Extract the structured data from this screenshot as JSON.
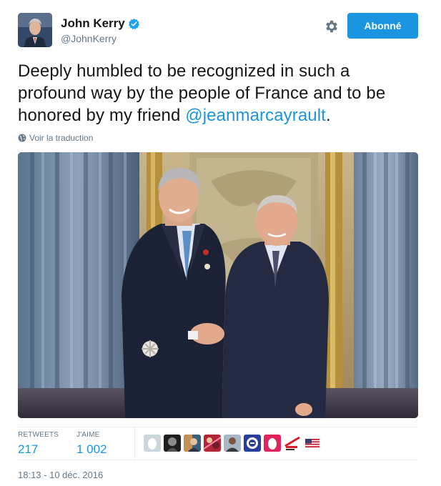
{
  "user": {
    "name": "John Kerry",
    "handle": "@JohnKerry"
  },
  "follow_button": {
    "label": "Abonné"
  },
  "tweet": {
    "text_before": "Deeply humbled to be recognized in such a profound way by the people of France and to be honored by my friend ",
    "mention": "@jeanmarcayrault",
    "text_after": "."
  },
  "translate_link": "Voir la traduction",
  "stats": {
    "retweets_label": "RETWEETS",
    "retweets_value": "217",
    "likes_label": "J'AIME",
    "likes_value": "1 002"
  },
  "liker_avatars": [
    "default-egg-avatar",
    "dark-portrait-avatar",
    "colorful-avatar",
    "red-pattern-avatar",
    "person-avatar",
    "blue-logo-avatar",
    "pink-egg-avatar",
    "text-logo-avatar",
    "us-flag-avatar"
  ],
  "timestamp": "18:13 - 10 déc. 2016",
  "colors": {
    "accent": "#1b95e0",
    "secondary_text": "#657786",
    "border": "#e6ecf0"
  }
}
